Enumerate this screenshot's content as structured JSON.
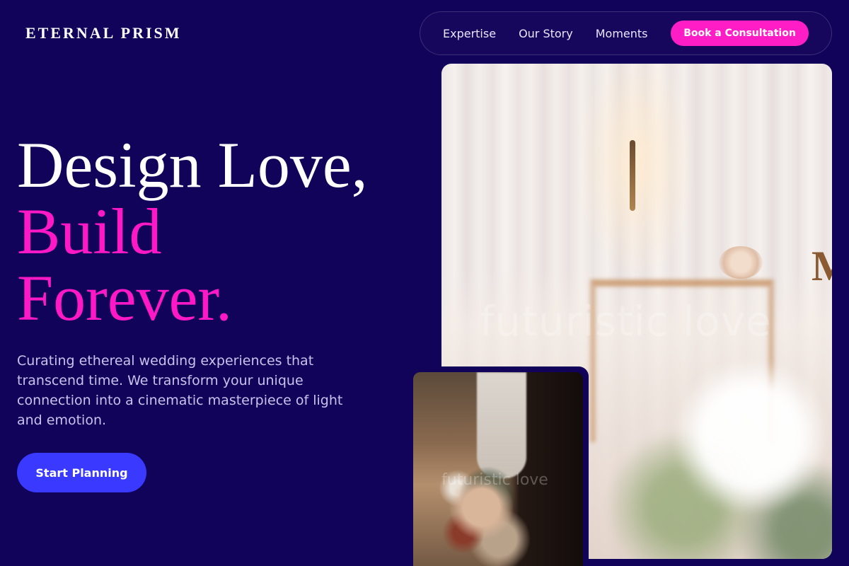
{
  "brand": {
    "logo": "ETERNAL PRISM"
  },
  "nav": {
    "links": [
      "Expertise",
      "Our Story",
      "Moments"
    ],
    "cta_label": "Book a Consultation"
  },
  "hero": {
    "headline_line1": "Design Love,",
    "headline_line2": "Build",
    "headline_line3": "Forever.",
    "description": "Curating ethereal wedding experiences that transcend time. We transform your unique connection into a cinematic masterpiece of light and emotion.",
    "cta_label": "Start Planning"
  },
  "images": {
    "main_watermark": "futuristic love",
    "main_letter": "M",
    "inset_watermark": "futuristic love"
  },
  "colors": {
    "background": "#12035a",
    "accent_pink": "#ff18c5",
    "button_blue": "#3a39ff",
    "text_muted": "#c8c2ec"
  }
}
